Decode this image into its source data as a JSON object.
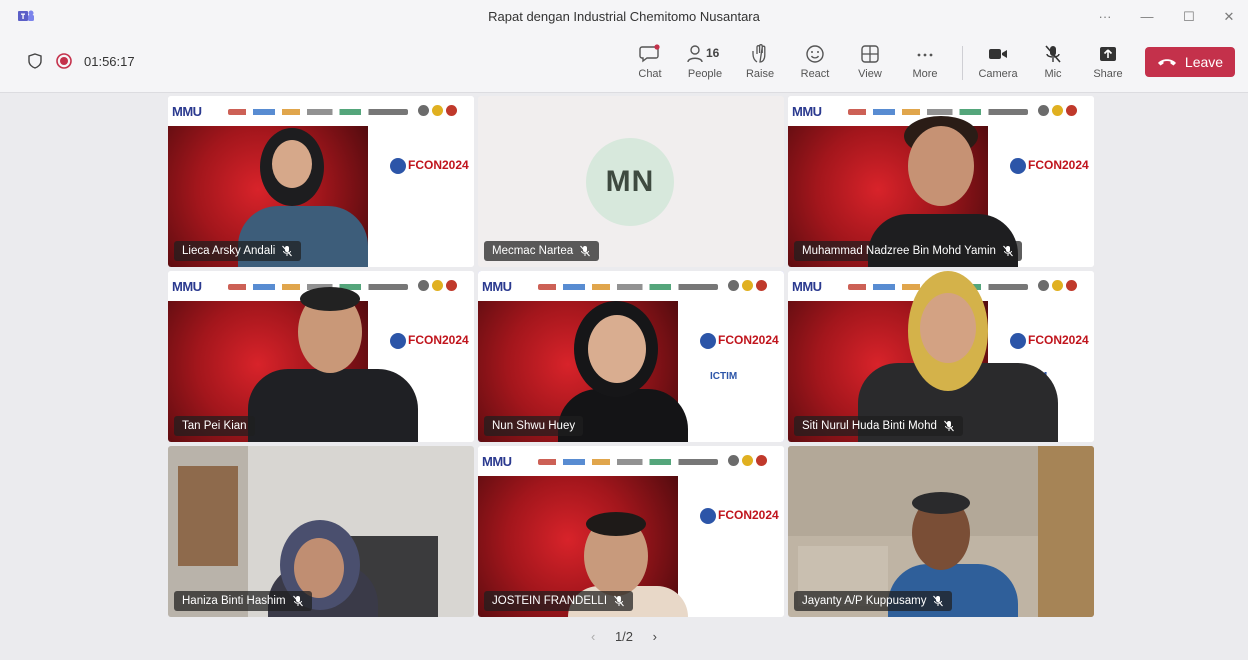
{
  "window": {
    "title": "Rapat dengan Industrial Chemitomo Nusantara"
  },
  "toolbar": {
    "timer": "01:56:17",
    "chat": "Chat",
    "people_count": "16",
    "people": "People",
    "raise": "Raise",
    "react": "React",
    "view": "View",
    "more": "More",
    "camera": "Camera",
    "mic": "Mic",
    "share": "Share",
    "leave": "Leave"
  },
  "participants": [
    {
      "name": "Lieca Arsky Andali"
    },
    {
      "name": "Mecmac Nartea",
      "initials": "MN"
    },
    {
      "name": "Muhammad Nadzree Bin Mohd Yamin"
    },
    {
      "name": "Tan Pei Kian"
    },
    {
      "name": "Nun Shwu Huey"
    },
    {
      "name": "Siti Nurul Huda Binti Mohd"
    },
    {
      "name": "Haniza Binti Hashim"
    },
    {
      "name": "JOSTEIN FRANDELLI"
    },
    {
      "name": "Jayanty A/P Kuppusamy"
    }
  ],
  "backdrop": {
    "sponsor_logo": "MMU",
    "conference": "FCON2024",
    "conference_secondary": "ICTIM"
  },
  "pager": {
    "label": "1/2"
  },
  "colors": {
    "leave": "#c4314b",
    "active_speaker": "#7f85f5",
    "recording": "#c4314b"
  }
}
